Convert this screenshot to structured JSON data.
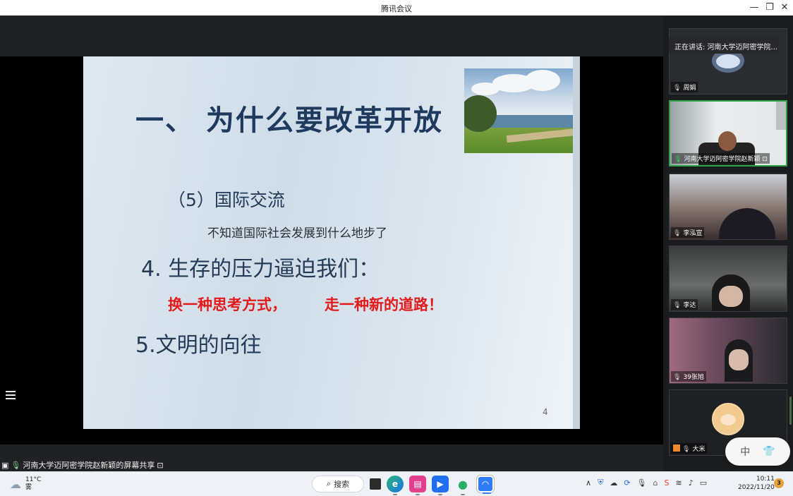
{
  "window": {
    "title": "腾讯会议",
    "minimize": "—",
    "restore": "❐",
    "close": "✕"
  },
  "slide": {
    "title": "一、 为什么要改革开放",
    "item_5_intl": "（5）国际交流",
    "item_5_note": "不知道国际社会发展到什么地步了",
    "item_4": "4. 生存的压力逼迫我们：",
    "slogan_1": "换一种思考方式，",
    "slogan_2": "走一种新的道路！",
    "item_5_civ": "5.文明的向往",
    "page_number": "4"
  },
  "share_bar": {
    "text": "河南大学迈阿密学院赵新颖的屏幕共享"
  },
  "sidebar": {
    "speaking_label": "正在讲话: 河南大学迈阿密学院...",
    "participants": [
      {
        "name": "周娟",
        "mic_on": false
      },
      {
        "name": "河南大学迈阿密学院赵新颖",
        "mic_on": true
      },
      {
        "name": "李泓宣",
        "mic_on": false
      },
      {
        "name": "李达",
        "mic_on": false
      },
      {
        "name": "39张旭",
        "mic_on": false
      },
      {
        "name": "大米",
        "mic_on": false
      }
    ]
  },
  "ime": {
    "mode": "中",
    "skin_icon": "shirt-icon"
  },
  "taskbar": {
    "weather_temp": "11°C",
    "weather_desc": "雾",
    "search_label": "搜索",
    "time": "10:11",
    "date": "2022/11/20",
    "notification_count": "3"
  },
  "colors": {
    "slide_title": "#1f3a5e",
    "slogan_red": "#e41a1a",
    "active_speaker": "#2fa24a"
  }
}
